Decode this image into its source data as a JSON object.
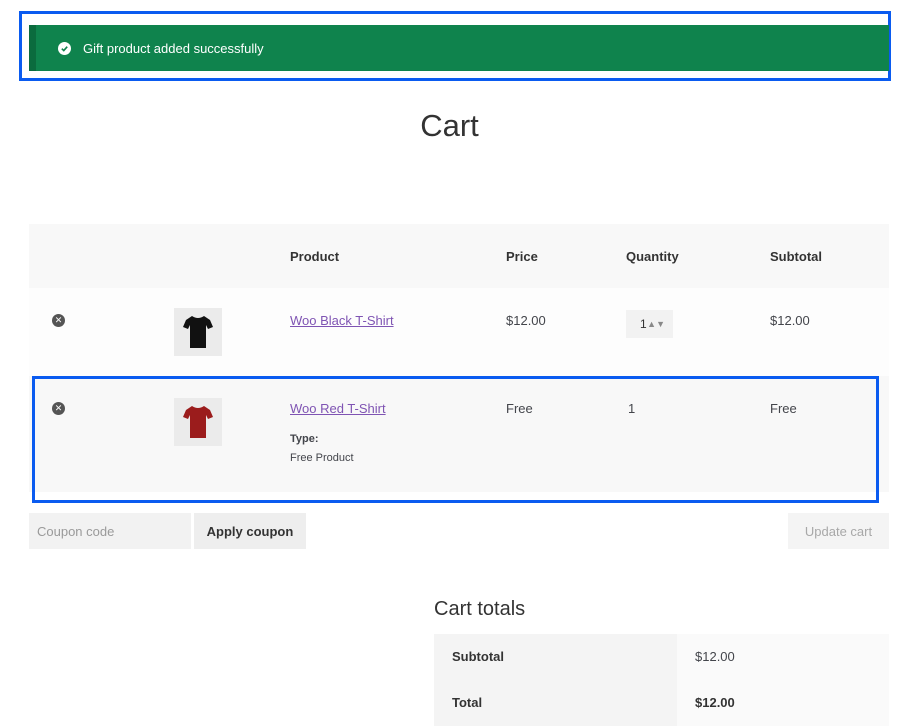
{
  "notice": {
    "text": "Gift product added successfully",
    "color": "#0f834d"
  },
  "page": {
    "title": "Cart"
  },
  "table": {
    "headers": {
      "product": "Product",
      "price": "Price",
      "quantity": "Quantity",
      "subtotal": "Subtotal"
    },
    "rows": [
      {
        "name": "Woo Black T-Shirt",
        "price": "$12.00",
        "quantity": "1",
        "subtotal": "$12.00",
        "shirt_color": "#111111"
      },
      {
        "name": "Woo Red T-Shirt",
        "price": "Free",
        "quantity": "1",
        "subtotal": "Free",
        "shirt_color": "#9b1c1c",
        "meta_label": "Type:",
        "meta_value": "Free Product"
      }
    ]
  },
  "coupon": {
    "placeholder": "Coupon code",
    "apply_label": "Apply coupon",
    "update_label": "Update cart"
  },
  "totals": {
    "title": "Cart totals",
    "subtotal_label": "Subtotal",
    "subtotal_value": "$12.00",
    "total_label": "Total",
    "total_value": "$12.00"
  },
  "colors": {
    "link": "#7f54b3",
    "highlight": "#0a5bf0"
  }
}
